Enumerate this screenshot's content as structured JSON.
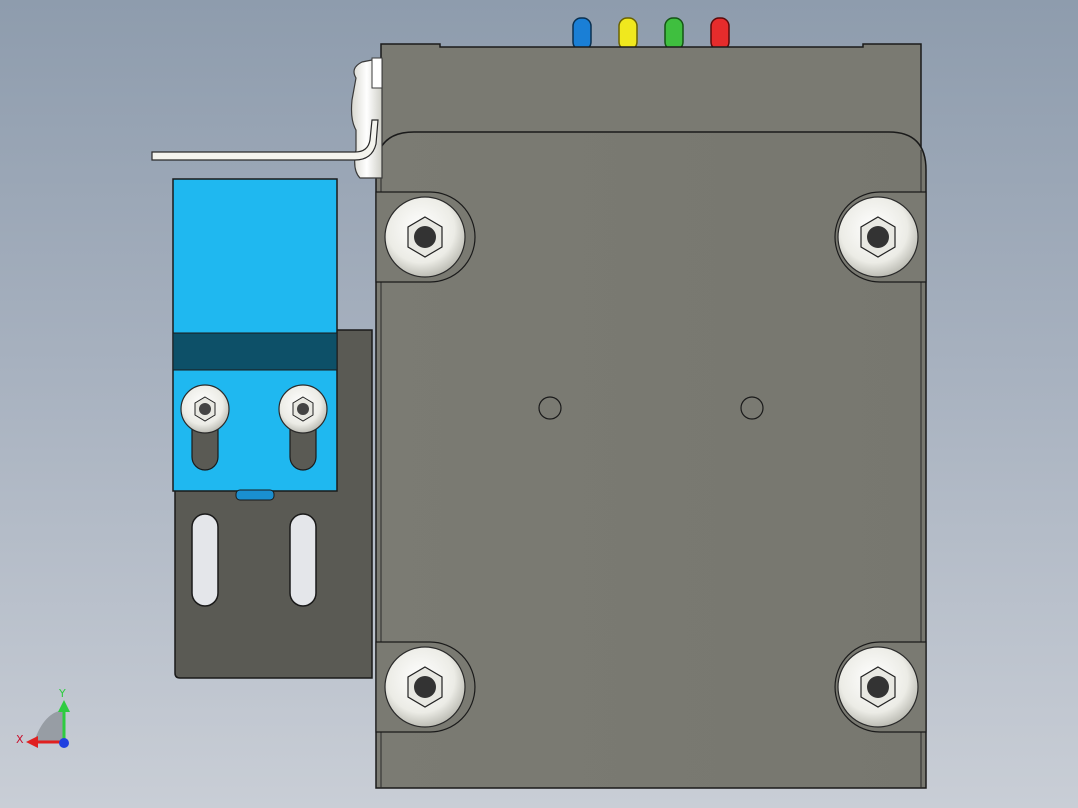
{
  "view": {
    "background_top": "#8e9cad",
    "background_bottom": "#c9ced6"
  },
  "model": {
    "body_color": "#7a7a72",
    "bracket_color": "#5a5a54",
    "sensor_color": "#1fb8f0",
    "sensor_band_color": "#0d5068",
    "screw_color": "#f2f2ec",
    "wire_colors": [
      "#1a7fd6",
      "#f0e81e",
      "#3fbf3f",
      "#e62c2c"
    ],
    "wire_names": [
      "blue-wire",
      "yellow-wire",
      "green-wire",
      "red-wire"
    ]
  },
  "triad": {
    "x_label": "X",
    "y_label": "Y",
    "x_color": "#e02020",
    "y_color": "#2ecc40",
    "z_color": "#2040e0"
  }
}
